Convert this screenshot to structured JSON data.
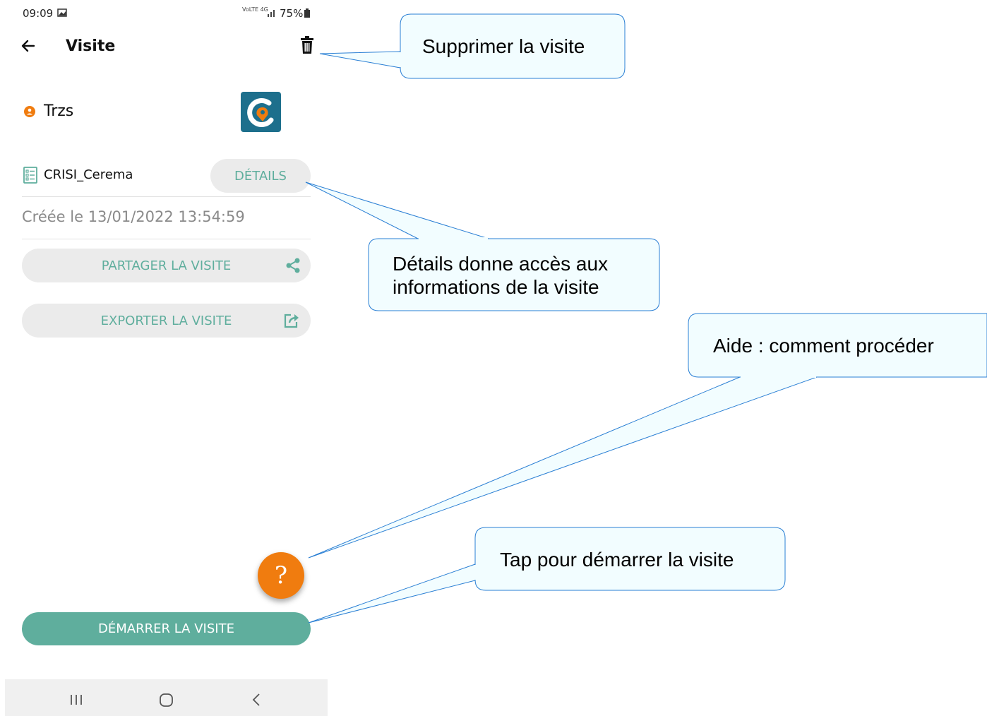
{
  "status_bar": {
    "time": "09:09",
    "network": "VoLTE 4G",
    "battery": "75%"
  },
  "header": {
    "back_icon": "arrow-left-icon",
    "title": "Visite",
    "delete_icon": "trash-icon"
  },
  "visit": {
    "name": "Trzs",
    "app_logo": "cerema-logo",
    "form_name": "CRISI_Cerema",
    "details_label": "DÉTAILS",
    "created": "Créée le 13/01/2022 13:54:59",
    "share_label": "PARTAGER LA VISITE",
    "export_label": "EXPORTER LA VISITE",
    "help_label": "?",
    "start_label": "DÉMARRER LA VISITE"
  },
  "colors": {
    "accent": "#5fae9d",
    "help": "#f07c0f",
    "callout_fill": "#f2fdff",
    "callout_stroke": "#2a7fd4"
  },
  "callouts": {
    "delete": "Supprimer la visite",
    "details_line1": "Détails donne accès aux",
    "details_line2": "informations de la visite",
    "help": "Aide : comment procéder",
    "start": "Tap pour démarrer la visite"
  },
  "nav": {
    "recent_icon": "recent-apps-icon",
    "home_icon": "home-icon",
    "back_icon": "nav-back-icon"
  }
}
